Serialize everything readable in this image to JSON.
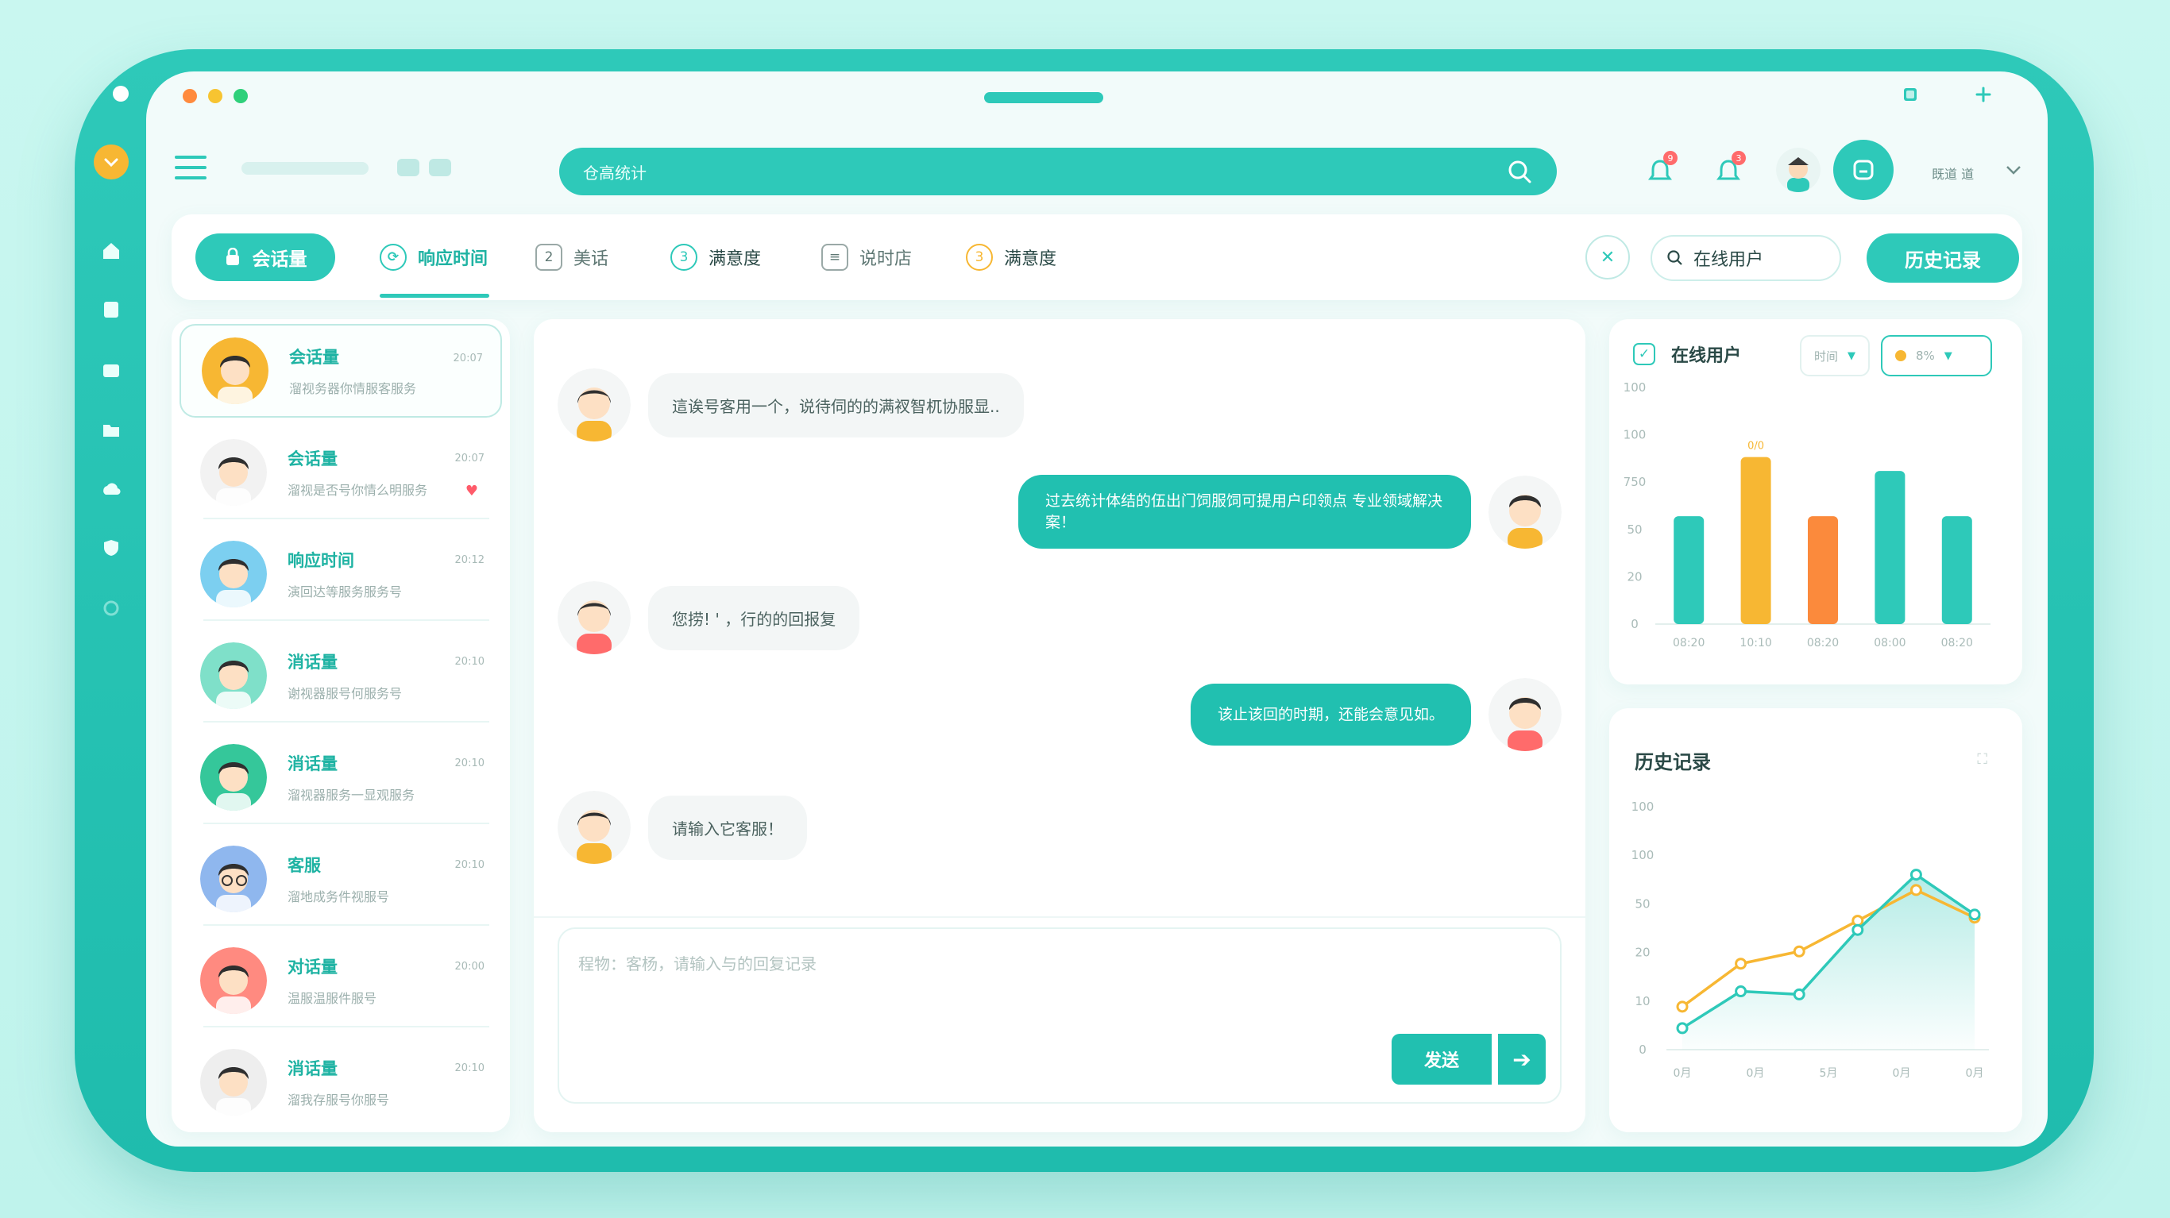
{
  "colors": {
    "accent": "#2ec9b9",
    "accent_dark": "#1fb3a3",
    "yellow": "#f7b733",
    "orange": "#fb8a3c",
    "badge": "#ff6b6b"
  },
  "topbar": {
    "search_placeholder": "仓高统计",
    "notif_badge_1": "9",
    "notif_badge_2": "3",
    "user_name": "既道 道"
  },
  "tabs": {
    "primary_label": "会话量",
    "items": [
      {
        "label": "响应时间",
        "icon": "clock-icon"
      },
      {
        "label": "美话",
        "icon": "2"
      },
      {
        "label": "满意度",
        "icon": "3"
      },
      {
        "label": "说时店",
        "icon": "doc-icon"
      },
      {
        "label": "满意度",
        "icon": "3"
      }
    ],
    "online_input_value": "在线用户",
    "history_button": "历史记录"
  },
  "conversations": [
    {
      "title": "会话量",
      "snippet": "溜视务器你情服客服务",
      "time": "20:07",
      "avatar": "avatar-boy-yellow"
    },
    {
      "title": "会话量",
      "snippet": "溜视是否号你情么明服务",
      "time": "20:07",
      "avatar": "avatar-boy-white",
      "heart": true
    },
    {
      "title": "响应时间",
      "snippet": "演回达等服务服务号",
      "time": "20:12",
      "avatar": "avatar-boy-blue"
    },
    {
      "title": "消话量",
      "snippet": "谢视器服号何服务号",
      "time": "20:10",
      "avatar": "avatar-boy-teal"
    },
    {
      "title": "消话量",
      "snippet": "溜视器服务一显观服务",
      "time": "20:10",
      "avatar": "avatar-boy-green"
    },
    {
      "title": "客服",
      "snippet": "溜地成务件视服号",
      "time": "20:10",
      "avatar": "avatar-boy-glasses"
    },
    {
      "title": "对话量",
      "snippet": "温服温服件服号",
      "time": "20:00",
      "avatar": "avatar-boy-red"
    },
    {
      "title": "消话量",
      "snippet": "溜我存服号你服号",
      "time": "20:10",
      "avatar": "avatar-boy-plain"
    }
  ],
  "chat": {
    "messages": [
      {
        "dir": "in",
        "text": "這诶号客用一个，说待伺的的满衩智杌协服显.."
      },
      {
        "dir": "out",
        "text": "过去统计体结的伍出门饲服饲可提用户印领点 专业领域解决案！"
      },
      {
        "dir": "in",
        "text": "您捞! ' ，行的的回报复"
      },
      {
        "dir": "out",
        "text": "该止该回的时期，还能会意见如。"
      },
      {
        "dir": "in",
        "text": "请输入它客服！"
      }
    ],
    "input_placeholder": "程物：客杨，请输入与的回复记录",
    "send_label": "发送"
  },
  "stats": {
    "title": "在线用户",
    "select_1": "时间",
    "select_2": "8%"
  },
  "history": {
    "title": "历史记录"
  },
  "chart_data": [
    {
      "type": "bar",
      "title": "在线用户",
      "categories": [
        "08:20",
        "10:10",
        "08:20",
        "08:00",
        "08:20"
      ],
      "y_ticks": [
        "0",
        "20",
        "50",
        "750",
        "100",
        "100"
      ],
      "values": [
        62,
        96,
        62,
        88,
        62
      ],
      "peak_label": "0/0",
      "colors": [
        "#2ec9b9",
        "#f7b733",
        "#fb8a3c",
        "#2ec9b9",
        "#2ec9b9"
      ],
      "ylim": [
        0,
        125
      ],
      "grid": false
    },
    {
      "type": "line",
      "title": "历史记录",
      "categories": [
        "0月",
        "0月",
        "5月",
        "0月",
        "0月"
      ],
      "y_ticks": [
        "0",
        "10",
        "20",
        "50",
        "100",
        "100"
      ],
      "series": [
        {
          "x": [
            0,
            1,
            2,
            3,
            4,
            5
          ],
          "values": [
            14,
            28,
            32,
            42,
            52,
            43
          ],
          "color": "#f7b733"
        },
        {
          "x": [
            0,
            1,
            2,
            3,
            4,
            5
          ],
          "values": [
            7,
            19,
            18,
            39,
            57,
            44
          ],
          "color": "#2ec9b9"
        }
      ],
      "ylim": [
        0,
        75
      ],
      "grid": false
    }
  ]
}
